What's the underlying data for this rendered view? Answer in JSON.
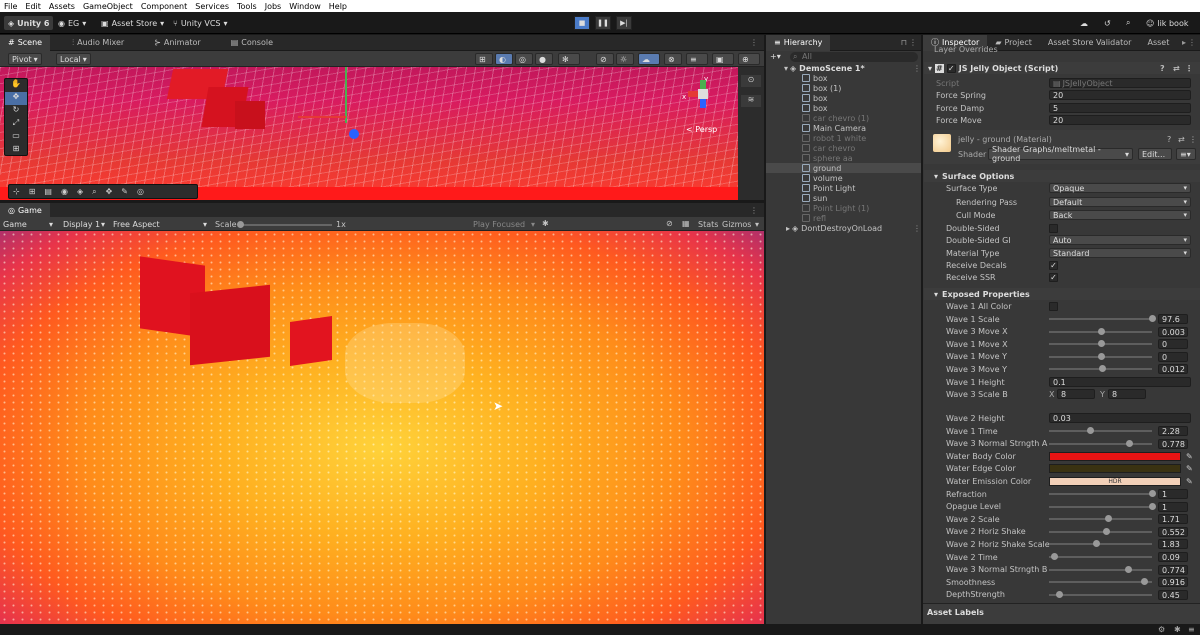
{
  "menubar": {
    "items": [
      "File",
      "Edit",
      "Assets",
      "GameObject",
      "Component",
      "Services",
      "Tools",
      "Jobs",
      "Window",
      "Help"
    ]
  },
  "toolbar": {
    "unity": "Unity 6",
    "account": "EG",
    "asset_store": "Asset Store",
    "vcs": "Unity VCS",
    "profile": "lik book"
  },
  "scene": {
    "tabs": [
      "Scene",
      "Audio Mixer",
      "Animator",
      "Console"
    ],
    "pivot": "Pivot",
    "local": "Local",
    "persp": "< Persp"
  },
  "game": {
    "tab": "Game",
    "mode": "Game",
    "display": "Display 1",
    "aspect": "Free Aspect",
    "scale_label": "Scale",
    "scale_value": "1x",
    "play_focused": "Play Focused",
    "stats": "Stats",
    "gizmos": "Gizmos"
  },
  "hierarchy": {
    "tab": "Hierarchy",
    "search_placeholder": "All",
    "scene": "DemoScene 1*",
    "items": [
      {
        "label": "box",
        "dim": false,
        "indent": 1
      },
      {
        "label": "box (1)",
        "dim": false,
        "indent": 1
      },
      {
        "label": "box",
        "dim": false,
        "indent": 1
      },
      {
        "label": "box",
        "dim": false,
        "indent": 1
      },
      {
        "label": "car chevro (1)",
        "dim": true,
        "indent": 1
      },
      {
        "label": "Main Camera",
        "dim": false,
        "indent": 1
      },
      {
        "label": "robot 1 white",
        "dim": true,
        "indent": 1
      },
      {
        "label": "car chevro",
        "dim": true,
        "indent": 1
      },
      {
        "label": "sphere aa",
        "dim": true,
        "indent": 1
      },
      {
        "label": "ground",
        "dim": false,
        "indent": 1
      },
      {
        "label": "volume",
        "dim": false,
        "indent": 1
      },
      {
        "label": "Point Light",
        "dim": false,
        "indent": 1
      },
      {
        "label": "sun",
        "dim": false,
        "indent": 1
      },
      {
        "label": "Point Light (1)",
        "dim": true,
        "indent": 1
      },
      {
        "label": "refl",
        "dim": true,
        "indent": 1
      }
    ],
    "dontdestroy": "DontDestroyOnLoad"
  },
  "inspector": {
    "tabs": [
      "Inspector",
      "Project",
      "Asset Store Validator",
      "Asset"
    ],
    "layer_overrides": "Layer Overrides",
    "component": "JS Jelly Object (Script)",
    "script_label": "Script",
    "script_value": "JSJellyObject",
    "fields": [
      {
        "label": "Force Spring",
        "value": "20"
      },
      {
        "label": "Force Damp",
        "value": "5"
      },
      {
        "label": "Force Move",
        "value": "20"
      }
    ],
    "material": "jelly - ground (Material)",
    "shader_label": "Shader",
    "shader_value": "Shader Graphs/meltmetal - ground",
    "edit": "Edit...",
    "surface_title": "Surface Options",
    "surface_type": "Surface Type",
    "surface_type_val": "Opaque",
    "render_pass": "Rendering Pass",
    "render_pass_val": "Default",
    "cull_mode": "Cull Mode",
    "cull_mode_val": "Back",
    "double_sided": "Double-Sided",
    "double_gi": "Double-Sided GI",
    "double_gi_val": "Auto",
    "material_type": "Material Type",
    "material_type_val": "Standard",
    "receive_decals": "Receive Decals",
    "receive_ssr": "Receive SSR",
    "exposed_title": "Exposed Properties",
    "wave1_all_color": "Wave 1 All Color",
    "sliders_a": [
      {
        "label": "Wave 1 Scale",
        "value": "97.6",
        "pos": 1.0
      },
      {
        "label": "Wave 3 Move X",
        "value": "0.003",
        "pos": 0.5
      },
      {
        "label": "Wave 1 Move X",
        "value": "0",
        "pos": 0.5
      },
      {
        "label": "Wave 1 Move Y",
        "value": "0",
        "pos": 0.5
      },
      {
        "label": "Wave 3 Move Y",
        "value": "0.012",
        "pos": 0.51
      }
    ],
    "wave1_height": "Wave 1 Height",
    "wave1_height_val": "0.1",
    "wave3_scale_b": "Wave 3 Scale B",
    "scale_b_x": "8",
    "scale_b_y": "8",
    "x_label": "X",
    "y_label": "Y",
    "wave2_height": "Wave 2 Height",
    "wave2_height_val": "0.03",
    "sliders_b": [
      {
        "label": "Wave 1 Time",
        "value": "2.28",
        "pos": 0.4
      },
      {
        "label": "Wave 3 Normal Strngth A",
        "value": "0.778",
        "pos": 0.78
      }
    ],
    "colors": [
      {
        "label": "Water Body Color",
        "color": "#e81313",
        "hdr": ""
      },
      {
        "label": "Water Edge Color",
        "color": "#3a3212",
        "hdr": ""
      },
      {
        "label": "Water Emission Color",
        "color": "#f2d0b8",
        "hdr": "HDR"
      }
    ],
    "sliders_c": [
      {
        "label": "Refraction",
        "value": "1",
        "pos": 1.0
      },
      {
        "label": "Opague Level",
        "value": "1",
        "pos": 1.0
      },
      {
        "label": "Wave 2 Scale",
        "value": "1.71",
        "pos": 0.57
      },
      {
        "label": "Wave 2 Horiz Shake",
        "value": "0.552",
        "pos": 0.55
      },
      {
        "label": "Wave 2 Horiz Shake Scale",
        "value": "1.83",
        "pos": 0.46
      },
      {
        "label": "Wave 2 Time",
        "value": "0.09",
        "pos": 0.05
      },
      {
        "label": "Wave 3 Normal Strngth B",
        "value": "0.774",
        "pos": 0.77
      },
      {
        "label": "Smoothness",
        "value": "0.916",
        "pos": 0.92
      },
      {
        "label": "DepthStrength",
        "value": "0.45",
        "pos": 0.1
      }
    ],
    "asset_labels": "Asset Labels"
  }
}
